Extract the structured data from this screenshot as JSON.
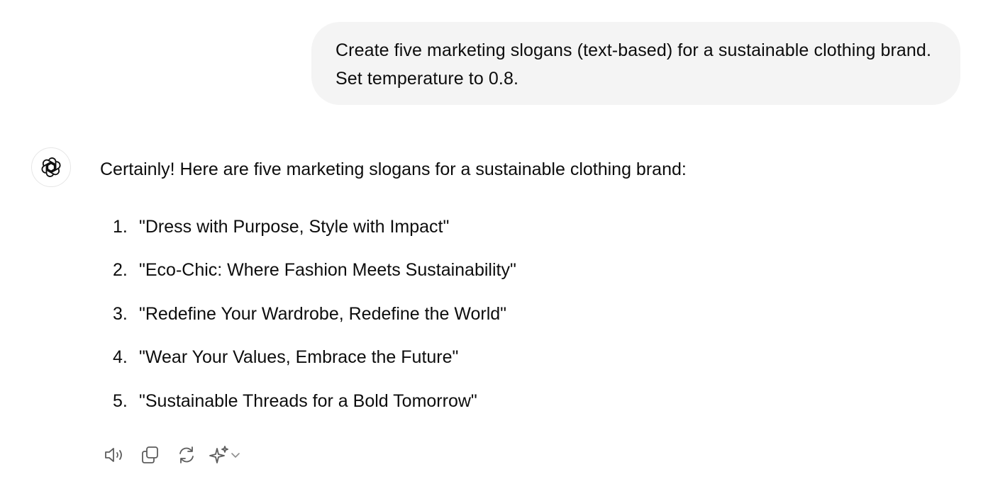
{
  "user_message": {
    "text": "Create five marketing slogans (text-based) for a sustainable clothing brand. Set temperature to 0.8."
  },
  "assistant_message": {
    "avatar_icon": "openai-logo-icon",
    "intro": "Certainly! Here are five marketing slogans for a sustainable clothing brand:",
    "slogans": [
      {
        "number": "1.",
        "text": "\"Dress with Purpose, Style with Impact\""
      },
      {
        "number": "2.",
        "text": "\"Eco-Chic: Where Fashion Meets Sustainability\""
      },
      {
        "number": "3.",
        "text": "\"Redefine Your Wardrobe, Redefine the World\""
      },
      {
        "number": "4.",
        "text": "\"Wear Your Values, Embrace the Future\""
      },
      {
        "number": "5.",
        "text": "\"Sustainable Threads for a Bold Tomorrow\""
      }
    ]
  },
  "actions": [
    {
      "icon": "speaker-icon"
    },
    {
      "icon": "copy-icon"
    },
    {
      "icon": "regenerate-icon"
    },
    {
      "icon": "sparkle-icon"
    },
    {
      "icon": "chevron-down-icon"
    }
  ],
  "colors": {
    "user_bubble_bg": "#f4f4f4",
    "text": "#0d0d0d",
    "icon": "#5d5d5d"
  }
}
